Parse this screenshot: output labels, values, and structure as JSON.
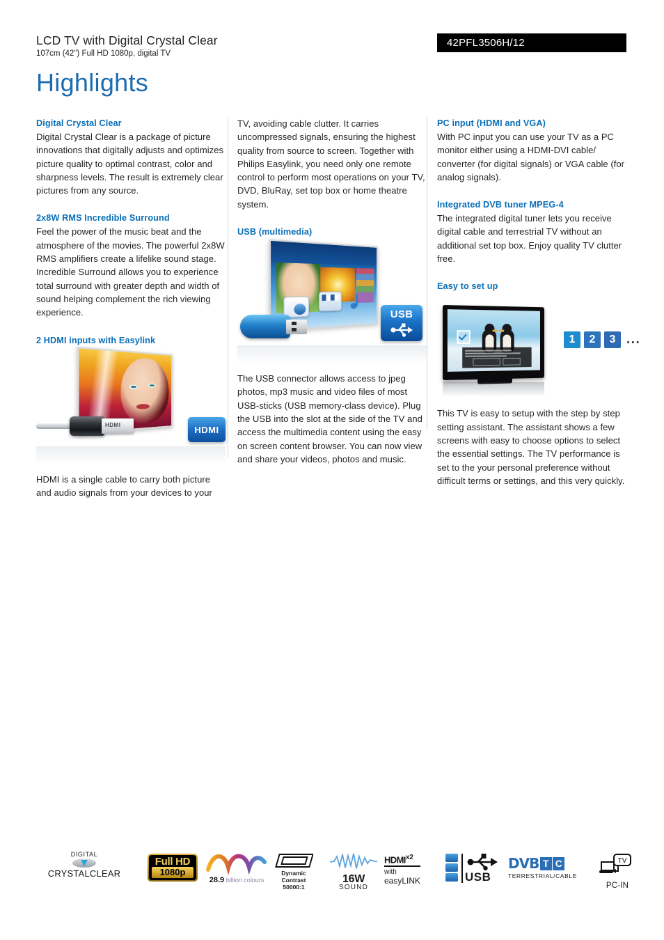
{
  "header": {
    "title": "LCD TV with Digital Crystal Clear",
    "subtitle": "107cm (42\") Full HD 1080p, digital TV",
    "model": "42PFL3506H/12",
    "page_title": "Highlights",
    "accent_color": "#1d6cb0",
    "heading_color": "#0a6fb8",
    "model_bar_color": "#000000"
  },
  "columns": {
    "col1": {
      "sections": [
        {
          "heading": "Digital Crystal Clear",
          "body": "Digital Crystal Clear is a package of picture innovations that digitally adjusts and optimizes picture quality to optimal contrast, color and sharpness levels. The result is extremely clear pictures from any source."
        },
        {
          "heading": "2x8W RMS Incredible Surround",
          "body": "Feel the power of the music beat and the atmosphere of the movies. The powerful 2x8W RMS amplifiers create a lifelike sound stage. Incredible Surround allows you to experience total surround with greater depth and width of sound helping complement the rich viewing experience."
        },
        {
          "heading": "2 HDMI inputs with Easylink",
          "figure": {
            "name": "hdmi-tv-cable-illustration",
            "cable_label": "HDMI",
            "badge_label": "HDMI"
          },
          "body": "HDMI is a single cable to carry both picture and audio signals from your devices to your"
        }
      ]
    },
    "col2": {
      "sections": [
        {
          "body": "TV, avoiding cable clutter. It carries uncompressed signals, ensuring the highest quality from source to screen. Together with Philips Easylink, you need only one remote control to perform most operations on your TV, DVD, BluRay, set top box or home theatre system."
        },
        {
          "heading": "USB (multimedia)",
          "figure": {
            "name": "usb-tv-illustration",
            "badge_label": "USB"
          },
          "body": "The USB connector allows access to jpeg photos, mp3 music and video files of most USB-sticks (USB memory-class device). Plug the USB into the slot at the side of the TV and access the multimedia content using the easy on screen content browser. You can now view and share your videos, photos and music."
        }
      ]
    },
    "col3": {
      "sections": [
        {
          "heading": "PC input (HDMI and VGA)",
          "body": "With PC input you can use your TV as a PC monitor either using a HDMI-DVI cable/ converter (for digital signals) or VGA cable (for analog signals)."
        },
        {
          "heading": "Integrated DVB tuner MPEG-4",
          "body": "The integrated digital tuner lets you receive digital cable and terrestrial TV without an additional set top box. Enjoy quality TV clutter free."
        },
        {
          "heading": "Easy to set up",
          "figure": {
            "name": "easy-setup-illustration",
            "step1": "1",
            "step2": "2",
            "step3": "3",
            "dots": "..."
          },
          "body": "This TV is easy to setup with the step by step setting assistant. The assistant shows a few screens with easy to choose options to select the essential settings. The TV performance is set to the your personal preference without difficult terms or settings, and this very quickly."
        }
      ]
    }
  },
  "footer_logos": {
    "digital_crystal_clear": {
      "line1": "DIGITAL",
      "line2": "CRYSTALCLEAR"
    },
    "full_hd": {
      "line1": "Full HD",
      "line2": "1080p"
    },
    "colours": {
      "number": "28.9",
      "text": "billion colours"
    },
    "dynamic_contrast": {
      "line1": "Dynamic Contrast",
      "line2": "50000:1"
    },
    "sound": {
      "line1": "16W",
      "line2": "SOUND"
    },
    "hdmi_easylink": {
      "line1": "HDMI",
      "qty": "x2",
      "line2": "with",
      "line3": "easyLINK"
    },
    "usb": {
      "label": "USB"
    },
    "dvb": {
      "mark": "DVB",
      "t": "T",
      "c": "C",
      "sub": "TERRESTRIAL/CABLE"
    },
    "pc_in": {
      "tv": "TV",
      "label": "PC-IN"
    }
  }
}
